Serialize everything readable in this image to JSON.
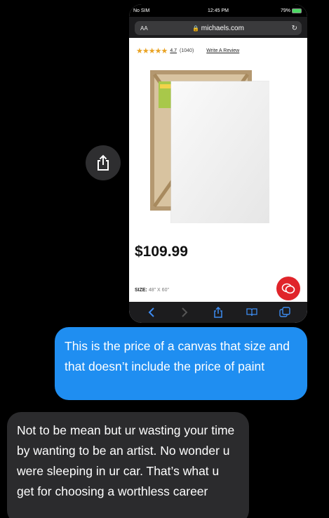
{
  "browser": {
    "carrier": "No SIM",
    "time": "12:45 PM",
    "battery": "79%",
    "text_size_label": "AA",
    "domain": "michaels.com"
  },
  "product": {
    "rating": "4.7",
    "review_count": "(1040)",
    "write_review": "Write A Review",
    "price": "$109.99",
    "size_label": "SIZE:",
    "size_value": "48\" X 60\""
  },
  "messages": {
    "sent": "This is the price of a canvas that size and that doesn’t include the price of paint",
    "received": "Not to be mean but ur wasting your time by wanting to be an artist. No wonder u were sleeping in ur car. That’s what u get for choosing a worthless career"
  },
  "colors": {
    "sent_bubble": "#1f8ef1",
    "received_bubble": "#2b2b2d",
    "star": "#e9a324",
    "chat_fab": "#e0242a"
  }
}
